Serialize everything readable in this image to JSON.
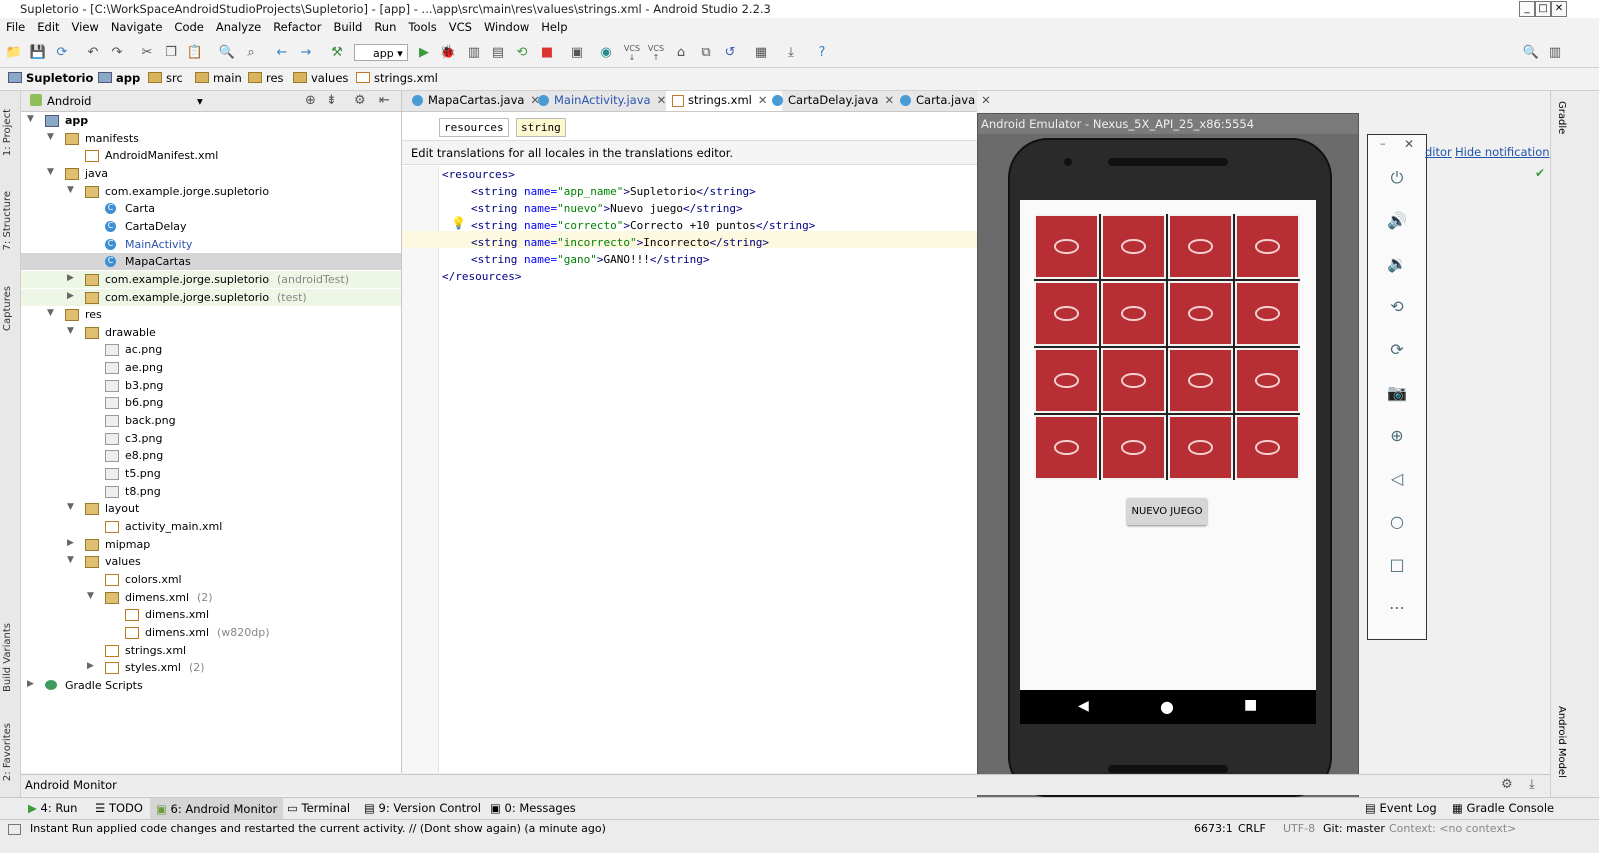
{
  "window": {
    "title": "Supletorio - [C:\\WorkSpaceAndroidStudioProjects\\Supletorio] - [app] - ...\\app\\src\\main\\res\\values\\strings.xml - Android Studio 2.2.3"
  },
  "menu": [
    "File",
    "Edit",
    "View",
    "Navigate",
    "Code",
    "Analyze",
    "Refactor",
    "Build",
    "Run",
    "Tools",
    "VCS",
    "Window",
    "Help"
  ],
  "toolbar": {
    "config": "app",
    "vcs1": "VCS",
    "vcs2": "VCS"
  },
  "breadcrumb": [
    "Supletorio",
    "app",
    "src",
    "main",
    "res",
    "values",
    "strings.xml"
  ],
  "left_strip": {
    "project": "1: Project",
    "structure": "7: Structure",
    "captures": "Captures",
    "build_variants": "Build Variants",
    "favorites": "2: Favorites"
  },
  "project": {
    "view": "Android",
    "tree": [
      {
        "label": "app",
        "bold": true
      },
      {
        "label": "manifests"
      },
      {
        "label": "AndroidManifest.xml"
      },
      {
        "label": "java"
      },
      {
        "label": "com.example.jorge.supletorio"
      },
      {
        "label": "Carta"
      },
      {
        "label": "CartaDelay"
      },
      {
        "label": "MainActivity"
      },
      {
        "label": "MapaCartas"
      },
      {
        "label": "com.example.jorge.supletorio",
        "suffix": "(androidTest)"
      },
      {
        "label": "com.example.jorge.supletorio",
        "suffix": "(test)"
      },
      {
        "label": "res"
      },
      {
        "label": "drawable"
      },
      {
        "label": "ac.png"
      },
      {
        "label": "ae.png"
      },
      {
        "label": "b3.png"
      },
      {
        "label": "b6.png"
      },
      {
        "label": "back.png"
      },
      {
        "label": "c3.png"
      },
      {
        "label": "e8.png"
      },
      {
        "label": "t5.png"
      },
      {
        "label": "t8.png"
      },
      {
        "label": "layout"
      },
      {
        "label": "activity_main.xml"
      },
      {
        "label": "mipmap"
      },
      {
        "label": "values"
      },
      {
        "label": "colors.xml"
      },
      {
        "label": "dimens.xml",
        "suffix": "(2)"
      },
      {
        "label": "dimens.xml"
      },
      {
        "label": "dimens.xml",
        "suffix": "(w820dp)"
      },
      {
        "label": "strings.xml"
      },
      {
        "label": "styles.xml",
        "suffix": "(2)"
      },
      {
        "label": "Gradle Scripts"
      }
    ]
  },
  "editor": {
    "tabs": [
      "MapaCartas.java",
      "MainActivity.java",
      "strings.xml",
      "CartaDelay.java",
      "Carta.java"
    ],
    "tag_crumbs": [
      "resources",
      "string"
    ],
    "translation_note": "Edit translations for all locales in the translations editor.",
    "lines": [
      {
        "open": "<resources>"
      },
      {
        "name": "app_name",
        "value": "Supletorio"
      },
      {
        "name": "nuevo",
        "value": "Nuevo juego"
      },
      {
        "name": "correcto",
        "value": "Correcto +10 puntos"
      },
      {
        "name": "incorrecto",
        "value": "Incorrecto"
      },
      {
        "name": "gano",
        "value": "GANO!!!"
      },
      {
        "close": "</resources>"
      }
    ]
  },
  "emulator": {
    "title": "Android Emulator - Nexus_5X_API_25_x86:5554",
    "button": "NUEVO JUEGO",
    "cards": 16
  },
  "notification": {
    "editor_link": "ditor",
    "hide": "Hide notification"
  },
  "right_strip": {
    "gradle": "Gradle",
    "android_model": "Android Model"
  },
  "monitor": {
    "label": "Android Monitor"
  },
  "bottom_tabs": [
    "4: Run",
    "TODO",
    "6: Android Monitor",
    "Terminal",
    "9: Version Control",
    "0: Messages",
    "Event Log",
    "Gradle Console"
  ],
  "status": {
    "message": "Instant Run applied code changes and restarted the current activity. // (Dont show again) (a minute ago)",
    "position": "6673:1",
    "line_sep": "CRLF",
    "encoding": "UTF-8",
    "git": "Git: master",
    "context": "Context: <no context>"
  }
}
